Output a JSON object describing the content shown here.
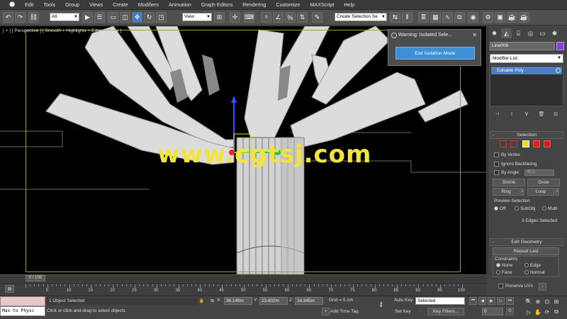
{
  "menu": {
    "items": [
      "Edit",
      "Tools",
      "Group",
      "Views",
      "Create",
      "Modifiers",
      "Animation",
      "Graph Editors",
      "Rendering",
      "Customize",
      "MAXScript",
      "Help"
    ]
  },
  "toolbar": {
    "filter_value": "All",
    "refcoord_value": "View",
    "selection_set_placeholder": "Create Selection Se"
  },
  "viewport": {
    "label": "[ + ] [ Perspective ] [ Smooth + Highlights + Edged Faces ]",
    "watermark": "www.cgtsj.com"
  },
  "isolate_popup": {
    "title": "Warning: Isolated Sele...",
    "close": "✕",
    "button": "Exit Isolation Mode"
  },
  "command_panel": {
    "object_name": "Line006",
    "object_color": "#8a3de0",
    "modifier_list": "Modifier List",
    "stack_item": "Editable Poly",
    "selection": {
      "title": "Selection",
      "by_vertex": "By Vertex",
      "ignore_backfacing": "Ignore Backfacing",
      "by_angle": "By Angle:",
      "angle_value": "45.0",
      "shrink": "Shrink",
      "grow": "Grow",
      "ring": "Ring",
      "loop": "Loop",
      "preview_title": "Preview Selection",
      "preview_off": "Off",
      "preview_subobj": "SubObj",
      "preview_multi": "Multi",
      "status": "3 Edges Selected"
    },
    "edit_geometry": {
      "title": "Edit Geometry",
      "repeat_last": "Repeat Last",
      "constraints": "Constraints",
      "none": "None",
      "edge": "Edge",
      "face": "Face",
      "normal": "Normal",
      "preserve_uvs": "Preserve UVs"
    }
  },
  "timeline": {
    "frame_display": "0 / 100",
    "ticks": [
      "5",
      "10",
      "15",
      "20",
      "25",
      "30",
      "35",
      "40",
      "45",
      "50",
      "55",
      "60",
      "65",
      "70",
      "75",
      "80",
      "85",
      "90",
      "95",
      "100"
    ]
  },
  "status": {
    "maxscript_text": "Max to Physc",
    "selected_text": "1 Object Selected",
    "prompt_text": "Click or click-and-drag to select objects",
    "x_label": "X:",
    "x_value": "36.149m",
    "y_label": "Y:",
    "y_value": "23.602m",
    "z_label": "Z:",
    "z_value": "24.345m",
    "grid": "Grid = 0.1m",
    "add_time_tag": "Add Time Tag",
    "auto_key": "Auto Key",
    "auto_key_mode": "Selected",
    "set_key": "Set Key",
    "key_filters": "Key Filters...",
    "current_frame": "0"
  },
  "colors": {
    "accent_blue": "#3d8fd6",
    "watermark_yellow": "#f2e43a",
    "viewport_border": "#a09a40"
  }
}
